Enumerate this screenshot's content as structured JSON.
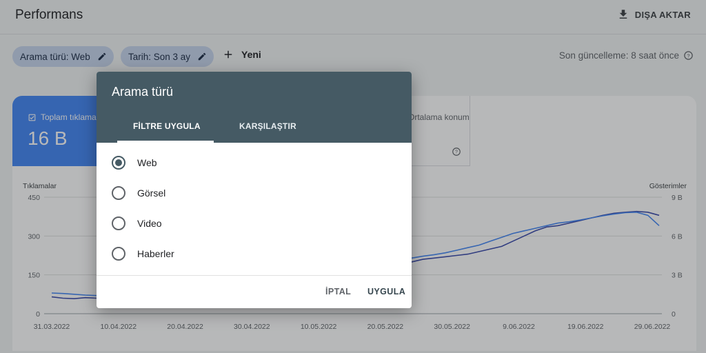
{
  "header": {
    "title": "Performans",
    "export_label": "DIŞA AKTAR",
    "export_icon": "download-icon"
  },
  "filters": {
    "search_type_chip": "Arama türü: Web",
    "date_chip": "Tarih: Son 3 ay",
    "new_label": "Yeni",
    "last_update": "Son güncelleme: 8 saat önce"
  },
  "metrics": {
    "clicks_label": "Toplam tıklama",
    "clicks_value": "16 B",
    "position_label": "Ortalama konum"
  },
  "chart_data": {
    "type": "line",
    "left_axis_label": "Tıklamalar",
    "right_axis_label": "Gösterimler",
    "left_ticks": [
      "0",
      "150",
      "300",
      "450"
    ],
    "right_ticks": [
      "0",
      "3 B",
      "6 B",
      "9 B"
    ],
    "ylim_left": [
      0,
      450
    ],
    "ylim_right": [
      0,
      9000000000
    ],
    "x_labels": [
      "31.03.2022",
      "10.04.2022",
      "20.04.2022",
      "30.04.2022",
      "10.05.2022",
      "20.05.2022",
      "30.05.2022",
      "9.06.2022",
      "19.06.2022",
      "29.06.2022"
    ],
    "grid": true,
    "colors": {
      "clicks": "#1a237e",
      "impressions": "#5e35b1"
    },
    "series": [
      {
        "values": [
          65,
          60,
          58,
          62,
          60,
          62,
          60,
          64,
          66,
          70,
          72,
          74,
          76,
          78,
          80,
          84,
          88,
          92,
          98,
          105,
          112,
          120,
          128,
          136,
          140,
          145,
          150,
          158,
          168,
          175,
          190,
          195,
          200,
          210,
          215,
          220,
          225,
          230,
          240,
          250,
          260,
          280,
          300,
          320,
          335,
          340,
          350,
          360,
          370,
          380,
          388,
          392,
          395,
          392,
          380
        ]
      },
      {
        "values": [
          80,
          78,
          75,
          72,
          70,
          72,
          74,
          76,
          78,
          80,
          84,
          88,
          92,
          96,
          100,
          104,
          108,
          114,
          120,
          128,
          136,
          144,
          150,
          158,
          165,
          175,
          185,
          190,
          195,
          200,
          205,
          210,
          215,
          222,
          228,
          235,
          245,
          255,
          265,
          280,
          295,
          310,
          320,
          330,
          340,
          350,
          355,
          362,
          370,
          378,
          385,
          390,
          392,
          380,
          340
        ]
      }
    ]
  },
  "dialog": {
    "title": "Arama türü",
    "tab_filter": "FİLTRE UYGULA",
    "tab_compare": "KARŞILAŞTIR",
    "options": [
      {
        "label": "Web",
        "checked": true
      },
      {
        "label": "Görsel",
        "checked": false
      },
      {
        "label": "Video",
        "checked": false
      },
      {
        "label": "Haberler",
        "checked": false
      }
    ],
    "cancel_label": "İPTAL",
    "apply_label": "UYGULA"
  }
}
